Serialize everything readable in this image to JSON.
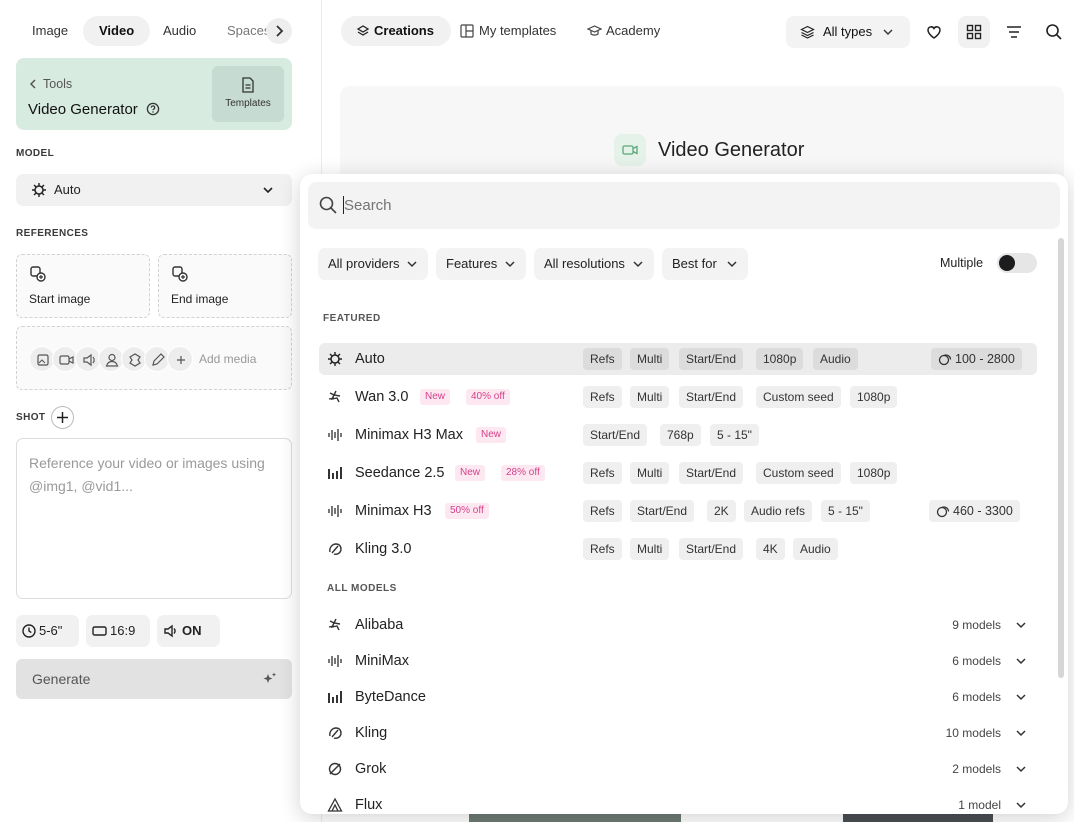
{
  "top_tabs": [
    "Image",
    "Video",
    "Audio",
    "Spaces"
  ],
  "tool_card": {
    "back_label": "Tools",
    "title": "Video Generator",
    "templates_label": "Templates"
  },
  "model": {
    "section_label": "MODEL",
    "selected": "Auto"
  },
  "references": {
    "section_label": "REFERENCES",
    "start": "Start image",
    "end": "End image",
    "add_media": "Add media"
  },
  "shot": {
    "section_label": "SHOT"
  },
  "prompt": {
    "placeholder": "Reference your video or images using @img1, @vid1..."
  },
  "settings": {
    "duration": "5-6\"",
    "ratio": "16:9",
    "audio": "ON"
  },
  "generate_label": "Generate",
  "right_header": {
    "tabs": [
      "Creations",
      "My templates",
      "Academy"
    ],
    "type_filter": "All types",
    "hero_title": "Video Generator"
  },
  "dropdown": {
    "search_placeholder": "Search",
    "filters": [
      "All providers",
      "Features",
      "All resolutions",
      "Best for"
    ],
    "multiple_label": "Multiple",
    "multiple_on": false,
    "featured_label": "FEATURED",
    "featured": [
      {
        "name": "Auto",
        "icon": "auto-icon",
        "tags": [],
        "chips": [
          "Refs",
          "Multi",
          "Start/End",
          "1080p",
          "Audio"
        ],
        "credits": "100 - 2800"
      },
      {
        "name": "Wan 3.0",
        "icon": "wan-icon",
        "tags": [
          "New",
          "40% off"
        ],
        "chips": [
          "Refs",
          "Multi",
          "Start/End",
          "Custom seed",
          "1080p"
        ],
        "credits": ""
      },
      {
        "name": "Minimax H3 Max",
        "icon": "minimax-icon",
        "tags": [
          "New"
        ],
        "chips": [
          "Start/End",
          "768p",
          "5 - 15\""
        ],
        "credits": ""
      },
      {
        "name": "Seedance 2.5",
        "icon": "bytedance-icon",
        "tags": [
          "New",
          "28% off"
        ],
        "chips": [
          "Refs",
          "Multi",
          "Start/End",
          "Custom seed",
          "1080p"
        ],
        "credits": ""
      },
      {
        "name": "Minimax H3",
        "icon": "minimax-icon",
        "tags": [
          "50% off"
        ],
        "chips": [
          "Refs",
          "Start/End",
          "2K",
          "Audio refs",
          "5 - 15\""
        ],
        "credits": "460 - 3300"
      },
      {
        "name": "Kling 3.0",
        "icon": "kling-icon",
        "tags": [],
        "chips": [
          "Refs",
          "Multi",
          "Start/End",
          "4K",
          "Audio"
        ],
        "credits": ""
      }
    ],
    "all_models_label": "ALL MODELS",
    "providers": [
      {
        "name": "Alibaba",
        "icon": "wan-icon",
        "count": "9 models"
      },
      {
        "name": "MiniMax",
        "icon": "minimax-icon",
        "count": "6 models"
      },
      {
        "name": "ByteDance",
        "icon": "bytedance-icon",
        "count": "6 models"
      },
      {
        "name": "Kling",
        "icon": "kling-icon",
        "count": "10 models"
      },
      {
        "name": "Grok",
        "icon": "grok-icon",
        "count": "2 models"
      },
      {
        "name": "Flux",
        "icon": "flux-icon",
        "count": "1 model"
      }
    ]
  },
  "colors": {
    "card_bg": "#d7ebe1",
    "tag_bg": "#fde8f2",
    "tag_text": "#d4428a",
    "highlight_row": "#ececec"
  }
}
